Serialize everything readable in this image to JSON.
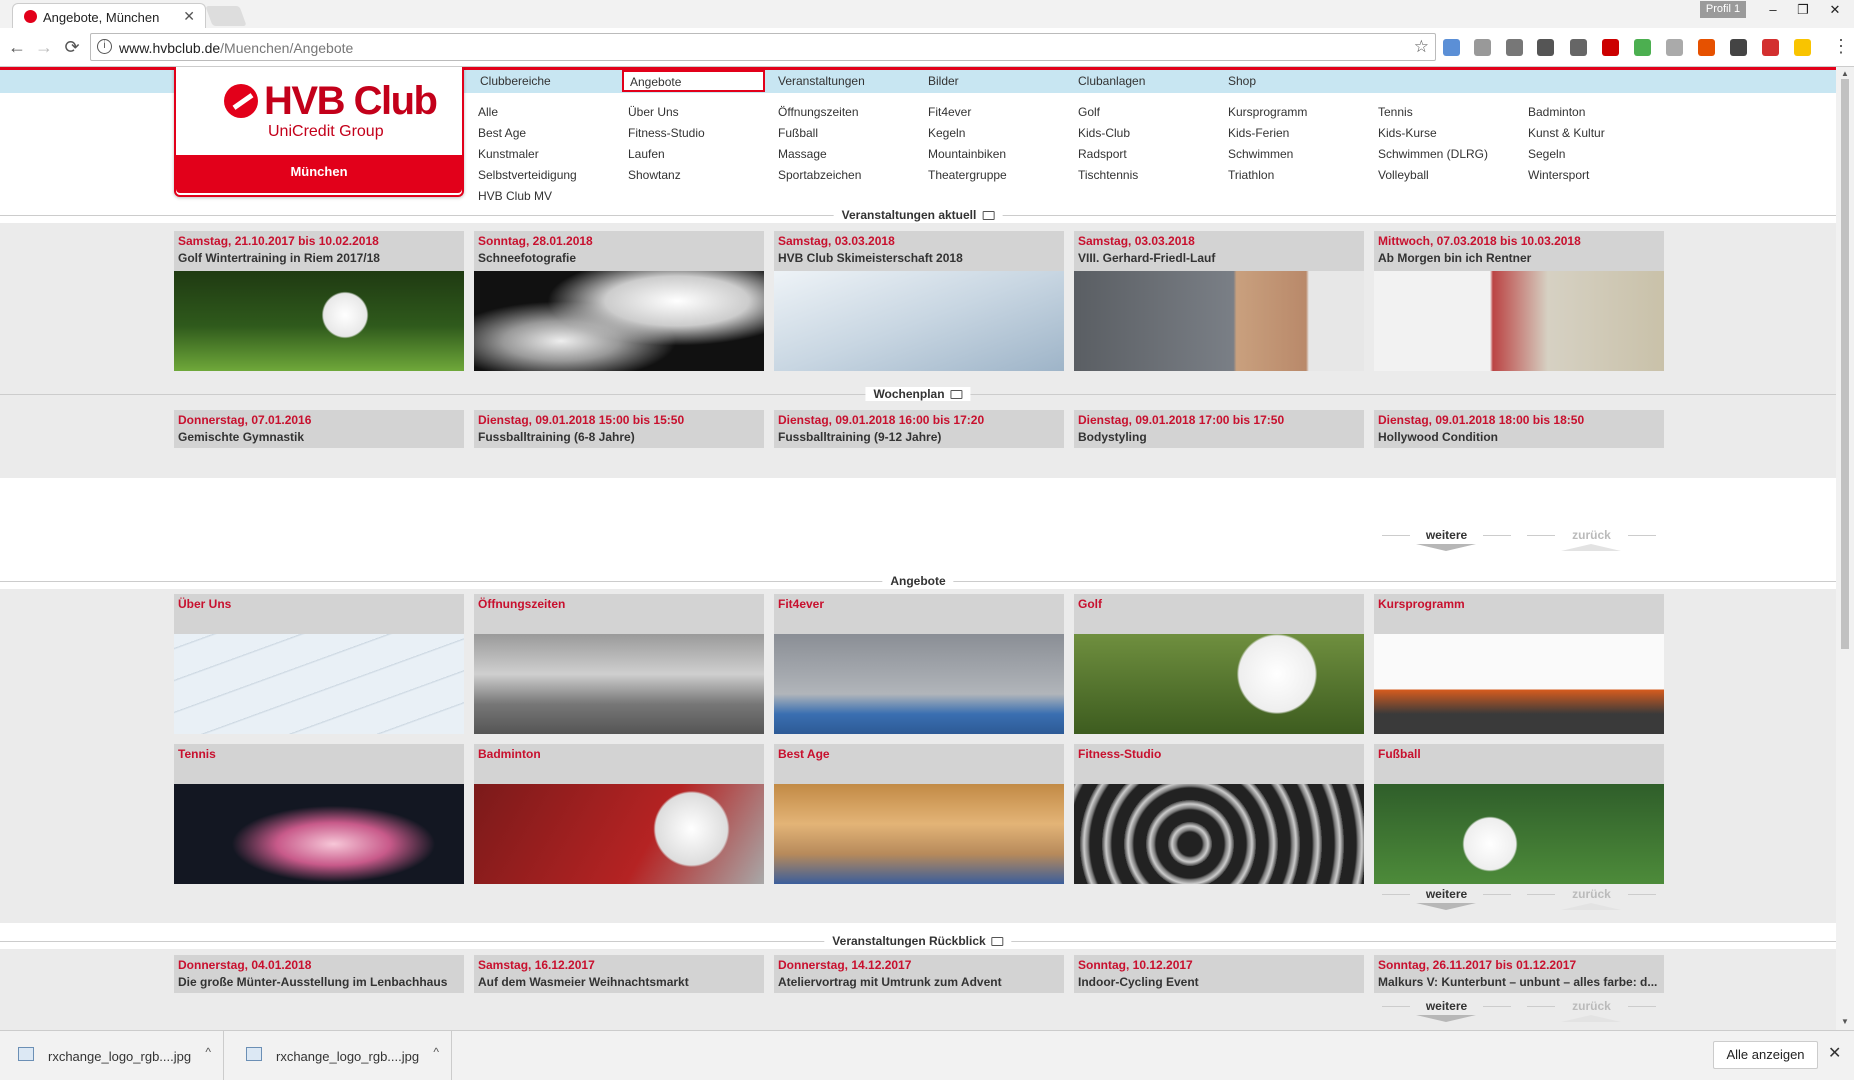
{
  "browser": {
    "tab_title": "Angebote, München",
    "profile": "Profil 1",
    "url_host": "www.hvbclub.de",
    "url_path": "/Muenchen/Angebote",
    "controls": {
      "back": "←",
      "forward": "→",
      "reload": "⟳",
      "minimize": "–",
      "restore": "❐",
      "close": "✕",
      "tab_close": "✕",
      "star": "☆",
      "info": "i",
      "menu": "⋮"
    }
  },
  "logo": {
    "brand": "HVB Club",
    "group": "UniCredit Group",
    "city": "München"
  },
  "nav": {
    "tabs": [
      "Clubbereiche",
      "Angebote",
      "Veranstaltungen",
      "Bilder",
      "Clubanlagen",
      "Shop"
    ],
    "active_tab": "Angebote",
    "columns": [
      [
        "Alle",
        "Best Age",
        "Kunstmaler",
        "Selbstverteidigung",
        "HVB Club MV"
      ],
      [
        "Über Uns",
        "Fitness-Studio",
        "Laufen",
        "Showtanz"
      ],
      [
        "Öffnungszeiten",
        "Fußball",
        "Massage",
        "Sportabzeichen"
      ],
      [
        "Fit4ever",
        "Kegeln",
        "Mountainbiken",
        "Theatergruppe"
      ],
      [
        "Golf",
        "Kids-Club",
        "Radsport",
        "Tischtennis"
      ],
      [
        "Kursprogramm",
        "Kids-Ferien",
        "Schwimmen",
        "Triathlon"
      ],
      [
        "Tennis",
        "Kids-Kurse",
        "Schwimmen (DLRG)",
        "Volleyball"
      ],
      [
        "Badminton",
        "Kunst & Kultur",
        "Segeln",
        "Wintersport"
      ]
    ]
  },
  "sections": {
    "events_current": "Veranstaltungen aktuell",
    "weekly_plan": "Wochenplan",
    "offers": "Angebote",
    "events_review": "Veranstaltungen Rückblick"
  },
  "pager": {
    "more": "weitere",
    "back": "zurück"
  },
  "events_current": [
    {
      "date": "Samstag, 21.10.2017 bis 10.02.2018",
      "title": "Golf Wintertraining in Riem 2017/18",
      "image": "golf-ball-photo"
    },
    {
      "date": "Sonntag, 28.01.2018",
      "title": "Schneefotografie",
      "image": "snow-photo"
    },
    {
      "date": "Samstag, 03.03.2018",
      "title": "HVB Club Skimeisterschaft 2018",
      "image": "ski-photo"
    },
    {
      "date": "Samstag, 03.03.2018",
      "title": "VIII. Gerhard-Friedl-Lauf",
      "image": "runner-photo"
    },
    {
      "date": "Mittwoch, 07.03.2018 bis 10.03.2018",
      "title": "Ab Morgen bin ich Rentner",
      "image": "theater-poster"
    }
  ],
  "weekly_plan": [
    {
      "date": "Donnerstag, 07.01.2016",
      "title": "Gemischte Gymnastik"
    },
    {
      "date": "Dienstag, 09.01.2018 15:00 bis 15:50",
      "title": "Fussballtraining (6-8 Jahre)"
    },
    {
      "date": "Dienstag, 09.01.2018 16:00 bis 17:20",
      "title": "Fussballtraining (9-12 Jahre)"
    },
    {
      "date": "Dienstag, 09.01.2018 17:00 bis 17:50",
      "title": "Bodystyling"
    },
    {
      "date": "Dienstag, 09.01.2018 18:00 bis 18:50",
      "title": "Hollywood Condition"
    }
  ],
  "offers": [
    {
      "title": "Über Uns",
      "image": "keyboard-photo"
    },
    {
      "title": "Öffnungszeiten",
      "image": "clubhouse-photo"
    },
    {
      "title": "Fit4ever",
      "image": "fitness-photo"
    },
    {
      "title": "Golf",
      "image": "golf-club-photo"
    },
    {
      "title": "Kursprogramm",
      "image": "stretching-photo"
    },
    {
      "title": "Tennis",
      "image": "tennis-photo"
    },
    {
      "title": "Badminton",
      "image": "shuttlecock-photo"
    },
    {
      "title": "Best Age",
      "image": "gymnastics-photo"
    },
    {
      "title": "Fitness-Studio",
      "image": "weights-photo"
    },
    {
      "title": "Fußball",
      "image": "football-photo"
    }
  ],
  "events_review": [
    {
      "date": "Donnerstag, 04.01.2018",
      "title": "Die große Münter-Ausstellung im Lenbachhaus"
    },
    {
      "date": "Samstag, 16.12.2017",
      "title": "Auf dem Wasmeier Weihnachtsmarkt"
    },
    {
      "date": "Donnerstag, 14.12.2017",
      "title": "Ateliervortrag mit Umtrunk zum Advent"
    },
    {
      "date": "Sonntag, 10.12.2017",
      "title": "Indoor-Cycling Event"
    },
    {
      "date": "Sonntag, 26.11.2017 bis 01.12.2017",
      "title": "Malkurs V: Kunterbunt – unbunt – alles farbe: d..."
    }
  ],
  "downloads": {
    "items": [
      "rxchange_logo_rgb....jpg",
      "rxchange_logo_rgb....jpg"
    ],
    "show_all": "Alle anzeigen",
    "close": "✕",
    "chevron": "^"
  },
  "colors": {
    "accent": "#e2001a",
    "date_red": "#c8102e",
    "nav_band": "#c8e6f2",
    "card_bg": "#d3d3d3"
  }
}
